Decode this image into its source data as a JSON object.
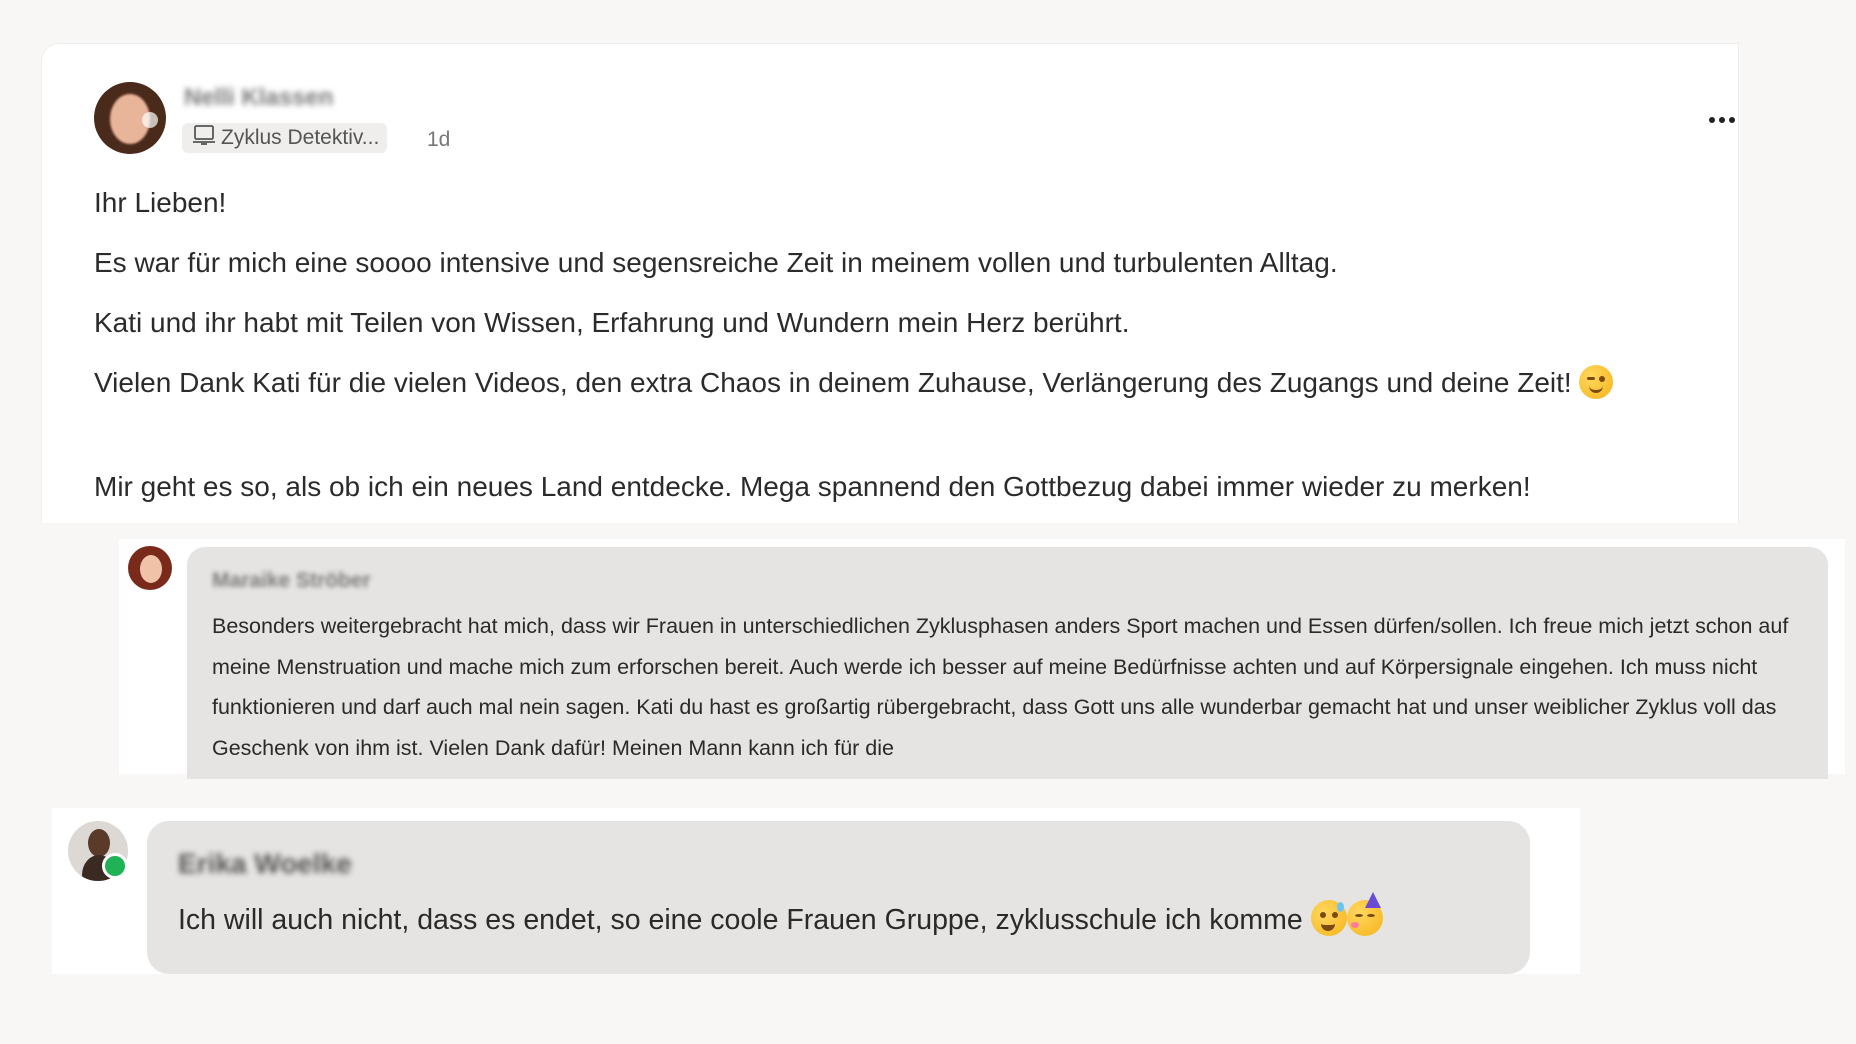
{
  "post": {
    "author": "Nelli Klassen",
    "space": "Zyklus Detektiv...",
    "time": "1d",
    "paragraphs": [
      "Ihr Lieben!",
      "Es war für mich eine soooo intensive und segensreiche Zeit in meinem vollen und turbulenten Alltag.",
      "Kati und ihr habt mit Teilen von Wissen, Erfahrung und Wundern mein Herz berührt.",
      "Vielen Dank Kati für die vielen Videos, den extra Chaos in deinem Zuhause, Verlängerung des Zugangs und deine Zeit!",
      "Mir geht es so, als ob ich ein neues Land entdecke. Mega spannend den Gottbezug dabei immer wieder zu merken!"
    ],
    "emoji_wink": "winking-face-emoji",
    "more_icon": "more-horizontal-icon"
  },
  "comment1": {
    "author": "Maraike Ströber",
    "text": "Besonders weitergebracht hat mich, dass wir Frauen in unterschiedlichen Zyklusphasen anders Sport machen und Essen dürfen/sollen. Ich freue mich jetzt schon auf meine Menstruation und mache mich zum erforschen bereit. Auch werde ich besser auf meine Bedürfnisse achten und auf Körpersignale eingehen. Ich muss nicht funktionieren und darf auch mal nein sagen. Kati du hast es großartig rübergebracht, dass Gott uns alle wunderbar gemacht hat und unser weiblicher Zyklus voll das Geschenk von ihm ist. Vielen Dank dafür! Meinen Mann kann ich für die"
  },
  "comment2": {
    "author": "Erika Woelke",
    "text": "Ich will auch nicht, dass es endet, so eine coole Frauen Gruppe, zyklusschule ich komme",
    "emojis": [
      "grinning-sweat-emoji",
      "partying-face-emoji"
    ]
  },
  "colors": {
    "background": "#f8f7f5",
    "bubble": "#e6e4e2",
    "online": "#1fb356"
  }
}
